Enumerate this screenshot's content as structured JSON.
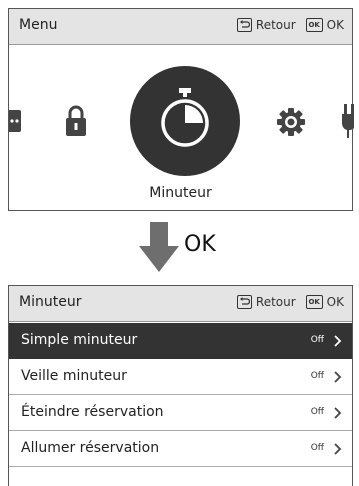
{
  "top_panel": {
    "title": "Menu",
    "back_label": "Retour",
    "ok_key": "OK",
    "ok_label": "OK",
    "selected_item_label": "Minuteur",
    "icons": [
      "grid-icon",
      "lock-icon",
      "timer-icon",
      "gear-icon",
      "plug-icon"
    ]
  },
  "transition": {
    "label": "OK"
  },
  "bottom_panel": {
    "title": "Minuteur",
    "back_label": "Retour",
    "ok_key": "OK",
    "ok_label": "OK",
    "items": [
      {
        "label": "Simple minuteur",
        "value": "Off",
        "selected": true
      },
      {
        "label": "Veille minuteur",
        "value": "Off",
        "selected": false
      },
      {
        "label": "Éteindre réservation",
        "value": "Off",
        "selected": false
      },
      {
        "label": "Allumer réservation",
        "value": "Off",
        "selected": false
      }
    ]
  },
  "colors": {
    "header_bg": "#e4e4e4",
    "selected_bg": "#333333",
    "icon_gray": "#444444"
  }
}
